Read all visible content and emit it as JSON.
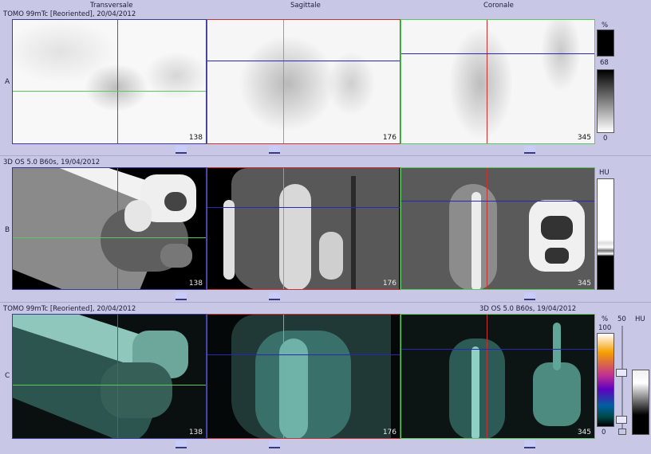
{
  "columns": {
    "transversale": "Transversale",
    "sagittale": "Sagittale",
    "coronale": "Coronale"
  },
  "rows": {
    "a": {
      "label": "A",
      "series": "TOMO 99mTc [Reoriented], 20/04/2012"
    },
    "b": {
      "label": "B",
      "series": "3D  OS  5.0  B60s, 19/04/2012"
    },
    "c": {
      "label": "C",
      "series_left": "TOMO 99mTc [Reoriented], 20/04/2012",
      "series_right": "3D  OS  5.0  B60s, 19/04/2012"
    }
  },
  "slices": {
    "trans": "138",
    "sag": "176",
    "cor": "345"
  },
  "scales": {
    "a": {
      "unit": "%",
      "max": "68",
      "min": "0"
    },
    "b": {
      "unit": "HU"
    },
    "c": {
      "unit_pct": "%",
      "max_pct": "100",
      "min_pct": "0",
      "mid": "50",
      "unit_hu": "HU"
    }
  },
  "colors": {
    "crosshair_red": "#c83232",
    "crosshair_green": "#5ac85a",
    "crosshair_blue": "#2828b4",
    "background": "#c8c8e6"
  }
}
